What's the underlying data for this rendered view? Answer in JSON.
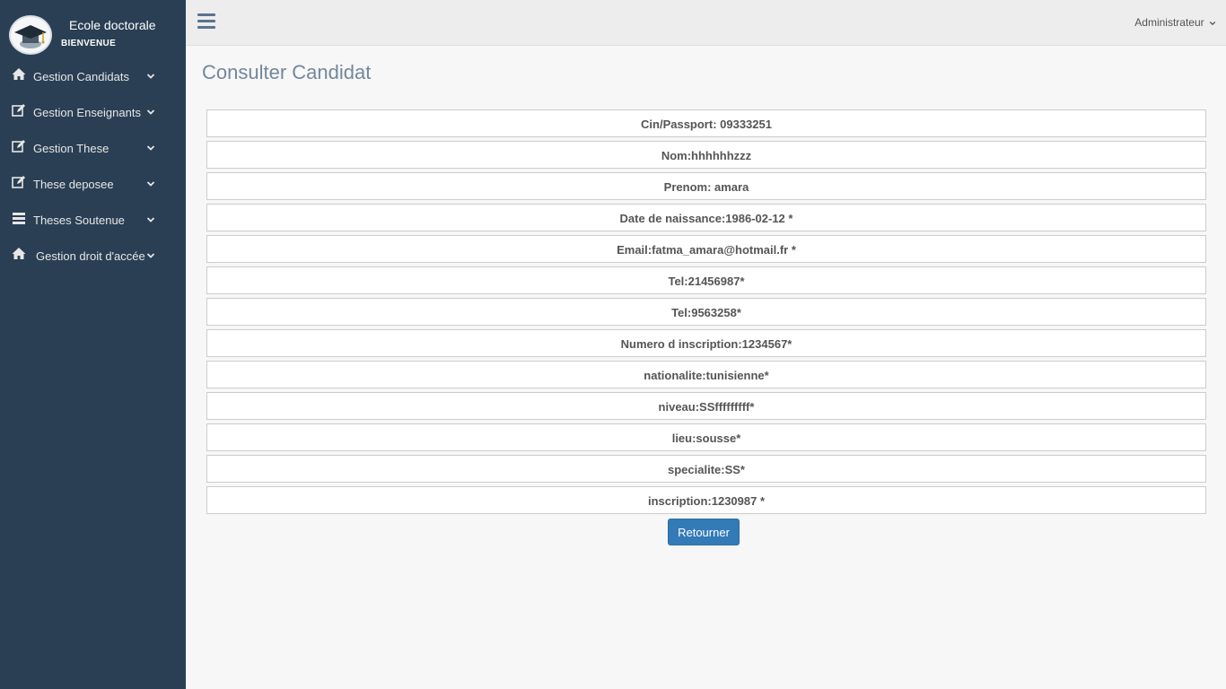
{
  "brand": {
    "title": "Ecole doctorale",
    "welcome": "BIENVENUE"
  },
  "sidebar": {
    "items": [
      {
        "label": "Gestion Candidats",
        "icon": "home-icon"
      },
      {
        "label": "Gestion Enseignants",
        "icon": "edit-icon"
      },
      {
        "label": "Gestion These",
        "icon": "edit-icon"
      },
      {
        "label": "These deposee",
        "icon": "edit-icon"
      },
      {
        "label": "Theses Soutenue",
        "icon": "list-icon"
      },
      {
        "label": "Gestion droit d'accée",
        "icon": "home-icon"
      }
    ]
  },
  "topnav": {
    "user": "Administrateur"
  },
  "page": {
    "title": "Consulter Candidat"
  },
  "candidate": {
    "fields": [
      "Cin/Passport: 09333251",
      "Nom:hhhhhhzzz",
      "Prenom: amara",
      "Date de naissance:1986-02-12 *",
      "Email:fatma_amara@hotmail.fr *",
      "Tel:21456987*",
      "Tel:9563258*",
      "Numero d inscription:1234567*",
      "nationalite:tunisienne*",
      "niveau:SSfffffffff*",
      "lieu:sousse*",
      "specialite:SS*",
      "inscription:1230987 *"
    ]
  },
  "actions": {
    "back_label": "Retourner"
  },
  "colors": {
    "sidebar_bg": "#2a3f54",
    "topnav_bg": "#ededed",
    "page_bg": "#f7f7f7",
    "primary_button": "#337ab7",
    "title_color": "#73879c"
  }
}
